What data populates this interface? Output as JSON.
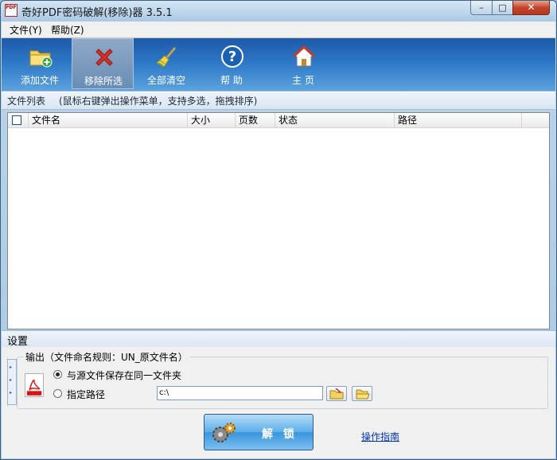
{
  "window": {
    "title": "奇好PDF密码破解(移除)器 3.5.1",
    "icon": "pdf-app-icon",
    "app_icon_text": "PDF",
    "controls": {
      "minimize": "–",
      "maximize": "□",
      "close": "✕"
    }
  },
  "menu": {
    "file": "文件(Y)",
    "help": "帮助(Z)"
  },
  "toolbar": {
    "add_file": "添加文件",
    "remove_selected": "移除所选",
    "clear_all": "全部清空",
    "help": "帮 助",
    "home": "主 页"
  },
  "file_list": {
    "section_label": "文件列表",
    "hint": "(鼠标右键弹出操作菜单，支持多选，拖拽排序)",
    "columns": [
      "文件名",
      "大小",
      "页数",
      "状态",
      "路径"
    ],
    "rows": []
  },
  "settings": {
    "section_label": "设置",
    "output_group_title": "输出（文件命名规则：UN_原文件名）",
    "option_same_folder": "与源文件保存在同一文件夹",
    "option_custom_path": "指定路径",
    "path_value": "c:\\",
    "selected_option": "same_folder"
  },
  "actions": {
    "unlock": "解 锁",
    "guide": "操作指南"
  },
  "colors": {
    "toolbar_top": "#1e5aa8",
    "toolbar_bottom": "#5ba2de",
    "close_button": "#c4462c",
    "link": "#0033cc"
  }
}
